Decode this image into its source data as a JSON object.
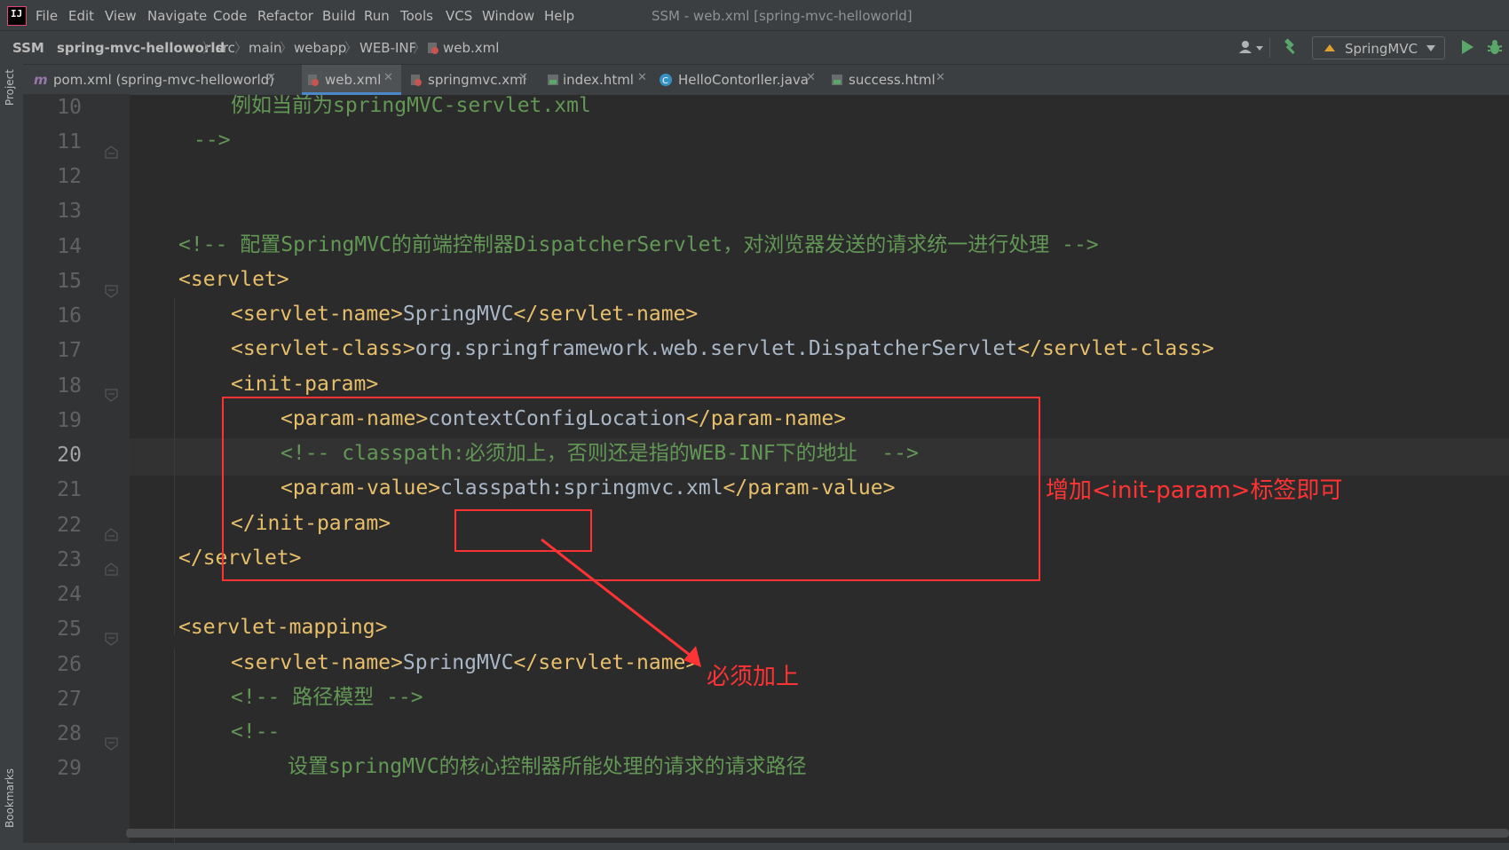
{
  "menu": {
    "items": [
      "File",
      "Edit",
      "View",
      "Navigate",
      "Code",
      "Refactor",
      "Build",
      "Run",
      "Tools",
      "VCS",
      "Window",
      "Help"
    ],
    "window_title": "SSM - web.xml [spring-mvc-helloworld]"
  },
  "breadcrumb": {
    "items": [
      "SSM",
      "spring-mvc-helloworld",
      "src",
      "main",
      "webapp",
      "WEB-INF",
      "web.xml"
    ]
  },
  "run_config": {
    "label": "SpringMVC"
  },
  "tabs": [
    {
      "label": "pom.xml (spring-mvc-helloworld)",
      "icon": "maven-icon"
    },
    {
      "label": "web.xml",
      "icon": "xml-config-icon",
      "active": true
    },
    {
      "label": "springmvc.xml",
      "icon": "xml-config-icon"
    },
    {
      "label": "index.html",
      "icon": "html-icon"
    },
    {
      "label": "HelloContorller.java",
      "icon": "java-class-icon"
    },
    {
      "label": "success.html",
      "icon": "html-icon"
    }
  ],
  "side_tools": {
    "project": "Project",
    "bookmarks": "Bookmarks"
  },
  "editor": {
    "current_line": 20,
    "line_numbers": [
      "10",
      "11",
      "12",
      "13",
      "14",
      "15",
      "16",
      "17",
      "18",
      "19",
      "20",
      "21",
      "22",
      "23",
      "24",
      "25",
      "26",
      "27",
      "28",
      "29"
    ],
    "lines": {
      "l10": "例如当前为springMVC-servlet.xml",
      "l11": "-->",
      "l14": "<!-- 配置SpringMVC的前端控制器DispatcherServlet，对浏览器发送的请求统一进行处理 -->",
      "l15_tag": "servlet",
      "l16_tag": "servlet-name",
      "l16_val": "SpringMVC",
      "l17_tag": "servlet-class",
      "l17_val": "org.springframework.web.servlet.DispatcherServlet",
      "l18_tag": "init-param",
      "l19_tag": "param-name",
      "l19_val": "contextConfigLocation",
      "l20": "<!-- classpath:必须加上，否则还是指的WEB-INF下的地址  -->",
      "l21_tag": "param-value",
      "l21_val1": "classpath:",
      "l21_val2": "springmvc.xml",
      "l22_tag": "init-param",
      "l23_tag": "servlet",
      "l25_tag": "servlet-mapping",
      "l26_tag": "servlet-name",
      "l26_val": "SpringMVC",
      "l27": "<!-- 路径模型 -->",
      "l28": "<!--",
      "l29": "设置springMVC的核心控制器所能处理的请求的请求路径"
    }
  },
  "annotations": {
    "init_param_note": "增加<init-param>标签即可",
    "classpath_note": "必须加上"
  },
  "colors": {
    "tag": "#e8bf6a",
    "comment": "#629755",
    "text": "#a9b7c6",
    "highlight": "#ff3333",
    "background": "#2b2b2b"
  }
}
